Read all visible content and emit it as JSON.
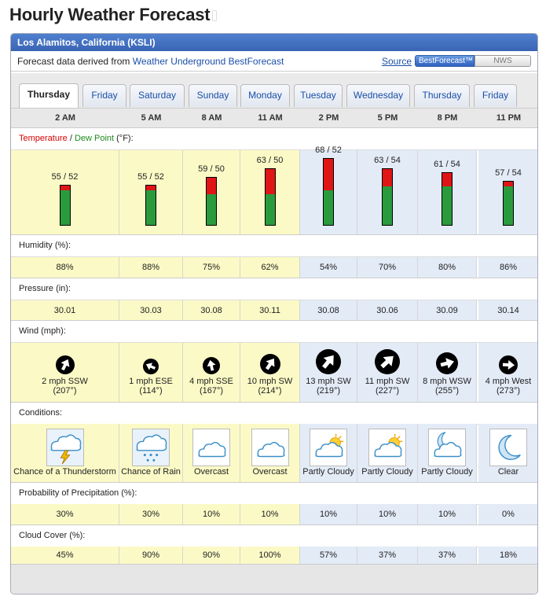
{
  "title": "Hourly Weather Forecast",
  "location": "Los Alamitos, California (KSLI)",
  "source_text_prefix": "Forecast data derived from ",
  "source_link": "Weather Underground BestForecast",
  "source_label": "Source",
  "source_options": [
    "BestForecast™",
    "NWS"
  ],
  "tabs": [
    "Thursday",
    "Friday",
    "Saturday",
    "Sunday",
    "Monday",
    "Tuesday",
    "Wednesday",
    "Thursday",
    "Friday"
  ],
  "hours": [
    "2 AM",
    "5 AM",
    "8 AM",
    "11 AM",
    "2 PM",
    "5 PM",
    "8 PM",
    "11 PM"
  ],
  "labels": {
    "temperature": "Temperature",
    "slash": " / ",
    "dew_point": "Dew Point",
    "unit": " (°F):",
    "humidity": "Humidity (%):",
    "pressure": "Pressure (in):",
    "wind": "Wind (mph):",
    "conditions": "Conditions:",
    "precip": "Probability of Precipitation (%):",
    "cloud": "Cloud Cover (%):"
  },
  "temps": [
    "55 / 52",
    "55 / 52",
    "59 / 50",
    "63 / 50",
    "68 / 52",
    "63 / 54",
    "61 / 54",
    "57 / 54"
  ],
  "humidity": [
    "88%",
    "88%",
    "75%",
    "62%",
    "54%",
    "70%",
    "80%",
    "86%"
  ],
  "pressure": [
    "30.01",
    "30.03",
    "30.08",
    "30.11",
    "30.08",
    "30.06",
    "30.09",
    "30.14"
  ],
  "wind_speed": [
    "2 mph SSW",
    "1 mph ESE",
    "4 mph SSE",
    "10 mph SW",
    "13 mph SW",
    "11 mph SW",
    "8 mph WSW",
    "4 mph West"
  ],
  "wind_deg": [
    "(207°)",
    "(114°)",
    "(167°)",
    "(214°)",
    "(219°)",
    "(227°)",
    "(255°)",
    "(273°)"
  ],
  "conditions": [
    "Chance of a Thunderstorm",
    "Chance of Rain",
    "Overcast",
    "Overcast",
    "Partly Cloudy",
    "Partly Cloudy",
    "Partly Cloudy",
    "Clear"
  ],
  "condition_icons": [
    "thunderstorm-icon",
    "rain-icon",
    "overcast-icon",
    "overcast-icon",
    "partly-cloudy-icon",
    "partly-cloudy-icon",
    "partly-cloudy-night-icon",
    "clear-night-icon"
  ],
  "precip": [
    "30%",
    "30%",
    "10%",
    "10%",
    "10%",
    "10%",
    "10%",
    "0%"
  ],
  "cloud": [
    "45%",
    "90%",
    "90%",
    "100%",
    "57%",
    "37%",
    "37%",
    "18%"
  ],
  "colors": {
    "day": "#fbfac6",
    "night": "#e3ebf7",
    "temperature": "#e01515",
    "dew_point": "#2a9b3d",
    "header": "#3a64b4"
  }
}
